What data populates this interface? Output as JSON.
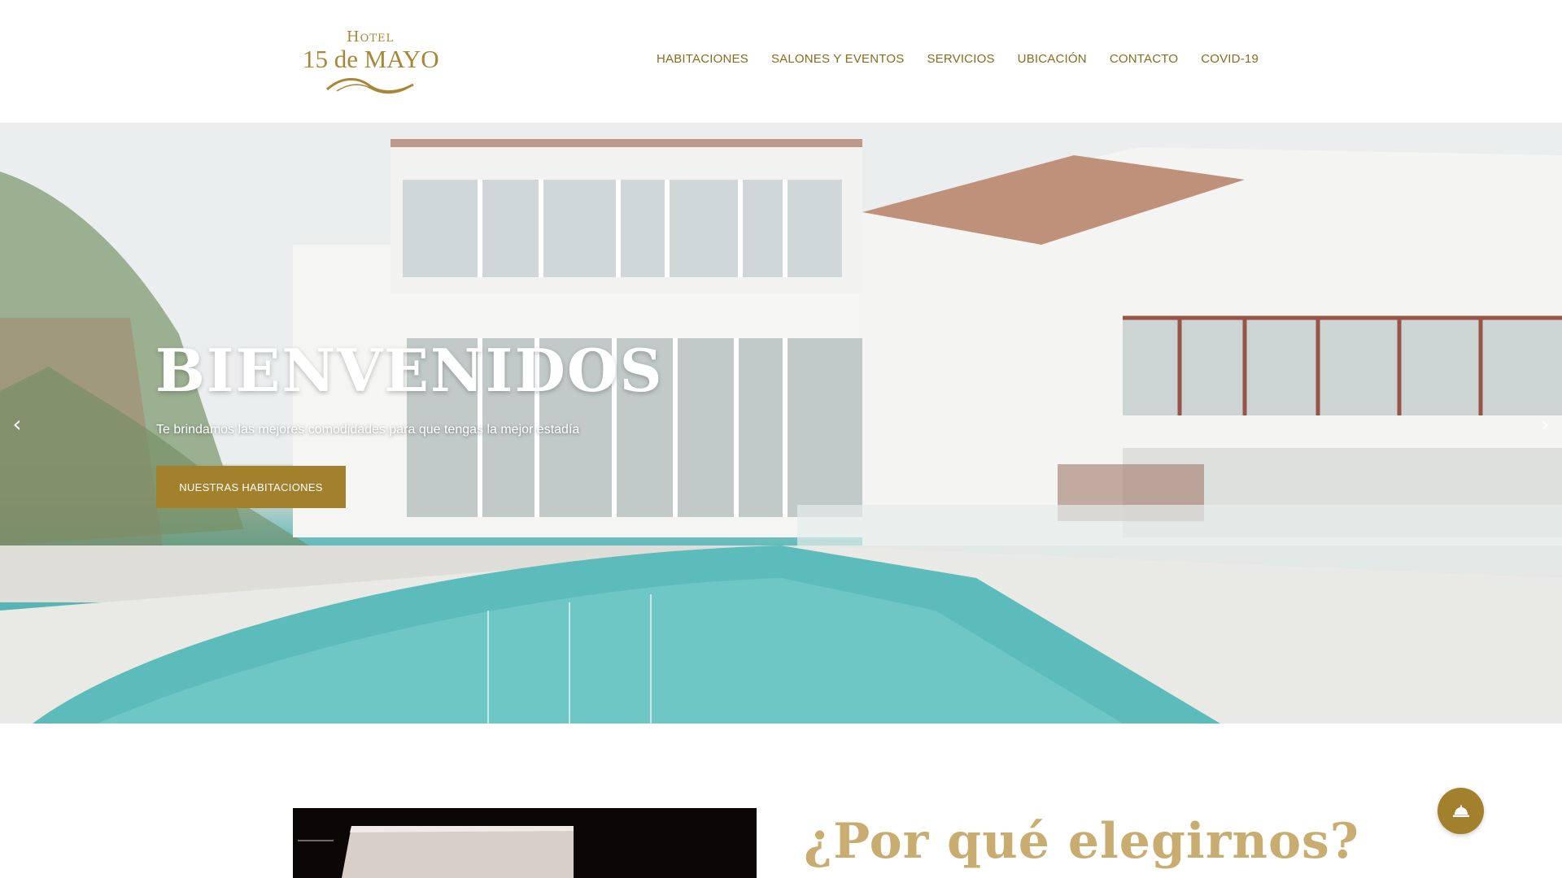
{
  "logo": {
    "line1": "Hotel",
    "line2": "15 de MAYO"
  },
  "nav": {
    "items": [
      {
        "label": "HABITACIONES"
      },
      {
        "label": "SALONES Y EVENTOS"
      },
      {
        "label": "SERVICIOS"
      },
      {
        "label": "UBICACIÓN"
      },
      {
        "label": "CONTACTO"
      },
      {
        "label": "COVID-19"
      }
    ]
  },
  "hero": {
    "title": "BIENVENIDOS",
    "subtitle": "Te brindamos las mejores comodidades para que tengas la mejor estadía",
    "button_label": "NUESTRAS HABITACIONES",
    "prev_icon": "chevron-left-icon",
    "next_icon": "chevron-right-icon"
  },
  "section": {
    "title": "¿Por qué elegirnos?"
  },
  "fab": {
    "icon": "reception-bell-icon"
  },
  "colors": {
    "gold": "#a3802c",
    "nav_text": "#8a6a1e",
    "title_gold": "#c9ac70",
    "pool": "#3aa6a8"
  }
}
